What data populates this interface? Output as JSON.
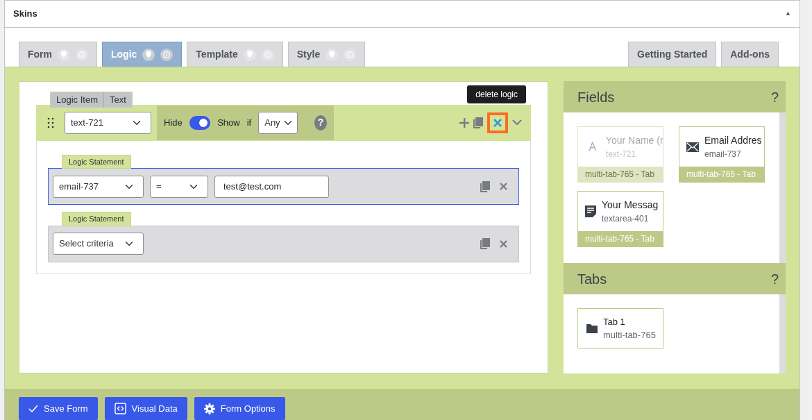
{
  "panel": {
    "title": "Skins",
    "collapse_glyph": "▲"
  },
  "tabs": [
    {
      "label": "Form",
      "selected": false
    },
    {
      "label": "Logic",
      "selected": true
    },
    {
      "label": "Template",
      "selected": false
    },
    {
      "label": "Style",
      "selected": false
    }
  ],
  "side_tabs": [
    {
      "label": "Getting Started"
    },
    {
      "label": "Add-ons"
    }
  ],
  "logic_item": {
    "labels": [
      "Logic Item",
      "Text"
    ],
    "field": "text-721",
    "hide_label": "Hide",
    "toggle_on": true,
    "show_label": "Show",
    "if_label": "if",
    "match": "Any",
    "help_glyph": "?",
    "tooltip": "delete logic",
    "statements": [
      {
        "label": "Logic Statement",
        "selected": true,
        "field": "email-737",
        "operator": "=",
        "value": "test@test.com"
      },
      {
        "label": "Logic Statement",
        "selected": false,
        "field": "Select criteria"
      }
    ]
  },
  "fields_panel": {
    "title": "Fields",
    "help": "?",
    "items": [
      {
        "kind": "text",
        "glyph": "A",
        "label": "Your Name (r",
        "name": "text-721",
        "tab": "multi-tab-765 - Tab",
        "disabled": true
      },
      {
        "kind": "email",
        "label": "Email Addres",
        "name": "email-737",
        "tab": "multi-tab-765 - Tab",
        "disabled": false
      },
      {
        "kind": "textarea",
        "label": "Your Messag",
        "name": "textarea-401",
        "tab": "multi-tab-765 - Tab",
        "disabled": false
      }
    ]
  },
  "tabs_panel": {
    "title": "Tabs",
    "help": "?",
    "items": [
      {
        "label": "Tab 1",
        "name": "multi-tab-765"
      }
    ]
  },
  "footer_buttons": [
    {
      "kind": "save",
      "label": "Save Form"
    },
    {
      "kind": "code",
      "label": "Visual Data"
    },
    {
      "kind": "gear",
      "label": "Form Options"
    }
  ]
}
